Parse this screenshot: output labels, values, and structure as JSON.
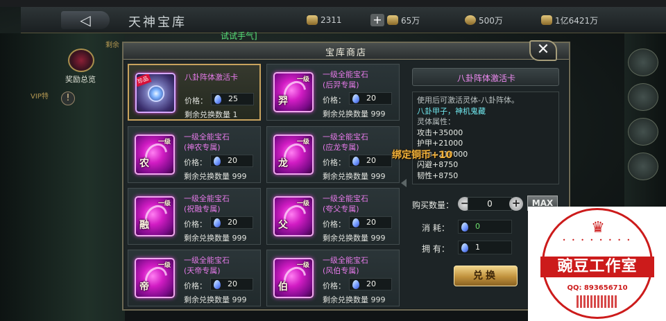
{
  "header": {
    "back_glyph": "◁",
    "title": "天神宝库",
    "resources": [
      {
        "icon": "gold-ingot-icon",
        "value": "2311"
      },
      {
        "icon": "lucky-bag-icon",
        "value": "65万"
      },
      {
        "icon": "coin-icon",
        "value": "500万"
      },
      {
        "icon": "coin-bag-icon",
        "value": "1亿6421万"
      }
    ],
    "plus_glyph": "+"
  },
  "background": {
    "try_luck": "试试手气]",
    "reward_overview": "奖励总览",
    "left_tags": [
      "剩余",
      "VIP特"
    ]
  },
  "dialog": {
    "title": "宝库商店",
    "close_glyph": "✕",
    "price_label": "价格：",
    "remain_label_prefix": "剩余兑换数量",
    "items": [
      {
        "name_lines": [
          "八卦阵体激活卡"
        ],
        "price": "25",
        "remain": "1",
        "hero": "",
        "kind": "card",
        "badge": "珍品",
        "selected": true
      },
      {
        "name_lines": [
          "一级全能宝石",
          "(后羿专属)"
        ],
        "price": "20",
        "remain": "999",
        "hero": "羿",
        "level": "一级",
        "kind": "gem",
        "selected": false
      },
      {
        "name_lines": [
          "一级全能宝石",
          "(神农专属)"
        ],
        "price": "20",
        "remain": "999",
        "hero": "农",
        "level": "一级",
        "kind": "gem",
        "selected": false
      },
      {
        "name_lines": [
          "一级全能宝石",
          "(应龙专属)"
        ],
        "price": "20",
        "remain": "999",
        "hero": "龙",
        "level": "一级",
        "kind": "gem",
        "selected": false
      },
      {
        "name_lines": [
          "一级全能宝石",
          "(祝融专属)"
        ],
        "price": "20",
        "remain": "999",
        "hero": "融",
        "level": "一级",
        "kind": "gem",
        "selected": false
      },
      {
        "name_lines": [
          "一级全能宝石",
          "(夸父专属)"
        ],
        "price": "20",
        "remain": "999",
        "hero": "父",
        "level": "一级",
        "kind": "gem",
        "selected": false
      },
      {
        "name_lines": [
          "一级全能宝石",
          "(天帝专属)"
        ],
        "price": "20",
        "remain": "999",
        "hero": "帝",
        "level": "一级",
        "kind": "gem",
        "selected": false
      },
      {
        "name_lines": [
          "一级全能宝石",
          "(风伯专属)"
        ],
        "price": "20",
        "remain": "999",
        "hero": "伯",
        "level": "一级",
        "kind": "gem",
        "selected": false
      }
    ],
    "detail": {
      "title": "八卦阵体激活卡",
      "desc": [
        {
          "text": "使用后可激活灵体-八卦阵体。",
          "style": "normal"
        },
        {
          "text": "八卦甲子，神机鬼藏",
          "style": "highlight"
        },
        {
          "text": "灵体属性：",
          "style": "normal"
        },
        {
          "text": "攻击+35000",
          "style": "stat"
        },
        {
          "text": "护甲+21000",
          "style": "stat"
        },
        {
          "text": "生命+210000",
          "style": "stat"
        },
        {
          "text": "闪避+8750",
          "style": "stat"
        },
        {
          "text": "韧性+8750",
          "style": "stat"
        }
      ],
      "qty_label": "购买数量：",
      "qty_value": "0",
      "minus_glyph": "−",
      "plus_glyph": "+",
      "max_label": "MAX",
      "cost_label": "消  耗：",
      "cost_value": "0",
      "own_label": "拥  有：",
      "own_value": "1",
      "exchange_label": "兑换"
    }
  },
  "float_text": "绑定铜币+10",
  "watermark": {
    "crown_glyph": "♛",
    "name": "豌豆工作室",
    "qq": "QQ: 893656710",
    "brand_color": "#cc1b1b"
  }
}
